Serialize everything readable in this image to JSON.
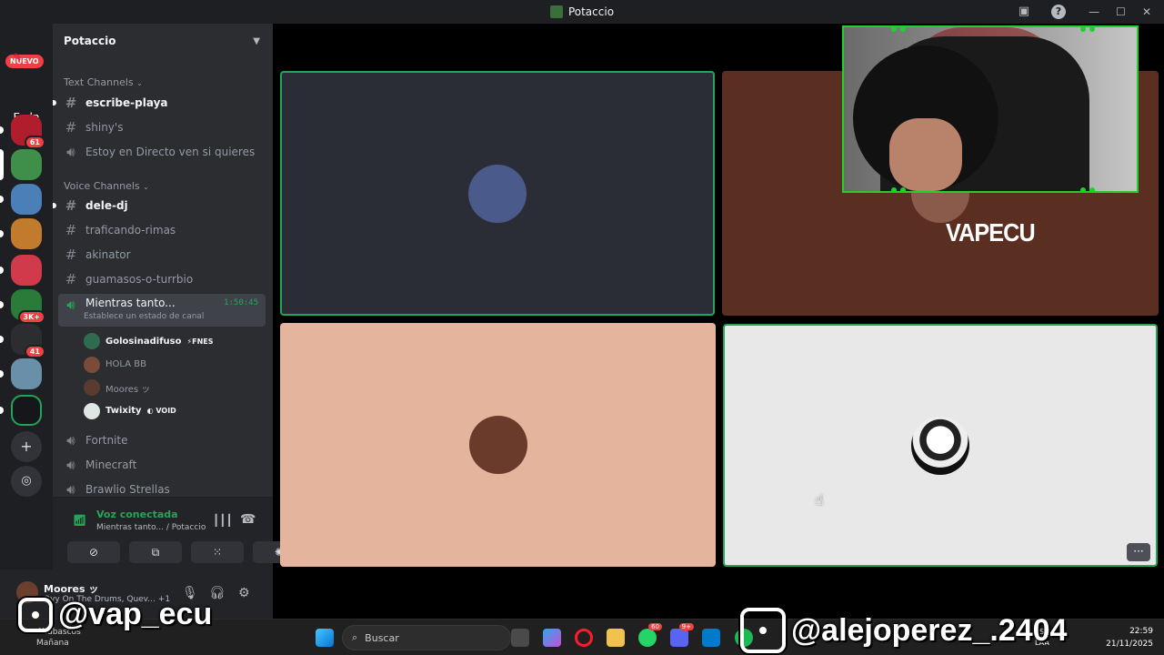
{
  "window": {
    "title": "Potaccio"
  },
  "rail": {
    "new_badge": "NUEVO",
    "server_label": "Esdn",
    "servers": [
      {
        "badge": "61",
        "color": "#b01d2d"
      },
      {
        "badge": "",
        "color": "#3f8f4a"
      },
      {
        "badge": "",
        "color": "#4b7fb8"
      },
      {
        "badge": "",
        "color": "#c27a2c"
      },
      {
        "badge": "",
        "color": "#d03a4a"
      },
      {
        "badge": "3K+",
        "color": "#2a7a3a"
      },
      {
        "badge": "41",
        "color": "#2b2d31"
      },
      {
        "badge": "",
        "color": "#6a8fa8"
      },
      {
        "badge": "",
        "color": "#15171a"
      }
    ],
    "add_icon": "+",
    "discover_icon": "compass-icon"
  },
  "guild": {
    "name": "Potaccio"
  },
  "categories": {
    "text": "Text Channels",
    "voice": "Voice Channels"
  },
  "text_channels": [
    {
      "name": "escribe-playa",
      "type": "text",
      "unread": true
    },
    {
      "name": "shiny's",
      "type": "text",
      "unread": false
    },
    {
      "name": "Estoy en Directo ven si quieres",
      "type": "voice",
      "unread": false
    }
  ],
  "voice_channels": [
    {
      "name": "dele-dj",
      "type": "text",
      "unread": true
    },
    {
      "name": "traficando-rimas",
      "type": "text",
      "unread": false
    },
    {
      "name": "akinator",
      "type": "text",
      "unread": false
    },
    {
      "name": "guamasos-o-turrbio",
      "type": "text",
      "unread": false
    }
  ],
  "active_channel": {
    "name": "Mientras tanto...",
    "timer": "1:50:45",
    "status": "Establece un estado de canal"
  },
  "voice_users": [
    {
      "name": "Golosinadifuso",
      "tag": "⚡FNES",
      "color": "#2f6b4f"
    },
    {
      "name": "HOLA BB",
      "tag": "",
      "color": "#7a4a3a"
    },
    {
      "name": "Moores ッ",
      "tag": "",
      "color": "#5a3b30"
    },
    {
      "name": "Twixity",
      "tag": "◐ VOID",
      "color": "#dfe6e3"
    }
  ],
  "more_channels": [
    "Fortnite",
    "Minecraft",
    "Brawlio Strellas"
  ],
  "voice_panel": {
    "status": "Voz conectada",
    "sub": "Mientras tanto... / Potaccio"
  },
  "user": {
    "name": "Moores ッ",
    "activity": "Ovy On The Drums, Quev...",
    "extra": "+1"
  },
  "tiles": [
    {
      "bg": "#2b2d36",
      "avatar_color": "#4a5a8a",
      "speaking": true
    },
    {
      "bg": "#5b2e22",
      "avatar_color": "#8a5a4a",
      "speaking": false
    },
    {
      "bg": "#e5b49c",
      "avatar_color": "#6a3a2a",
      "speaking": false
    },
    {
      "bg": "#e8e8e8",
      "avatar_color": "#222222",
      "speaking": true
    }
  ],
  "overlay": {
    "brand": "VAPECU",
    "ig_left": "@vap_ecu",
    "ig_right": "@alejoperez_.2404"
  },
  "taskbar": {
    "search": "Buscar",
    "weather_line1": "Chubascos",
    "weather_line2": "Mañana",
    "lang1": "ESP",
    "lang2": "LAA",
    "time": "22:59",
    "date": "21/11/2025",
    "whatsapp_badge": "60",
    "discord_badge": "9+"
  }
}
